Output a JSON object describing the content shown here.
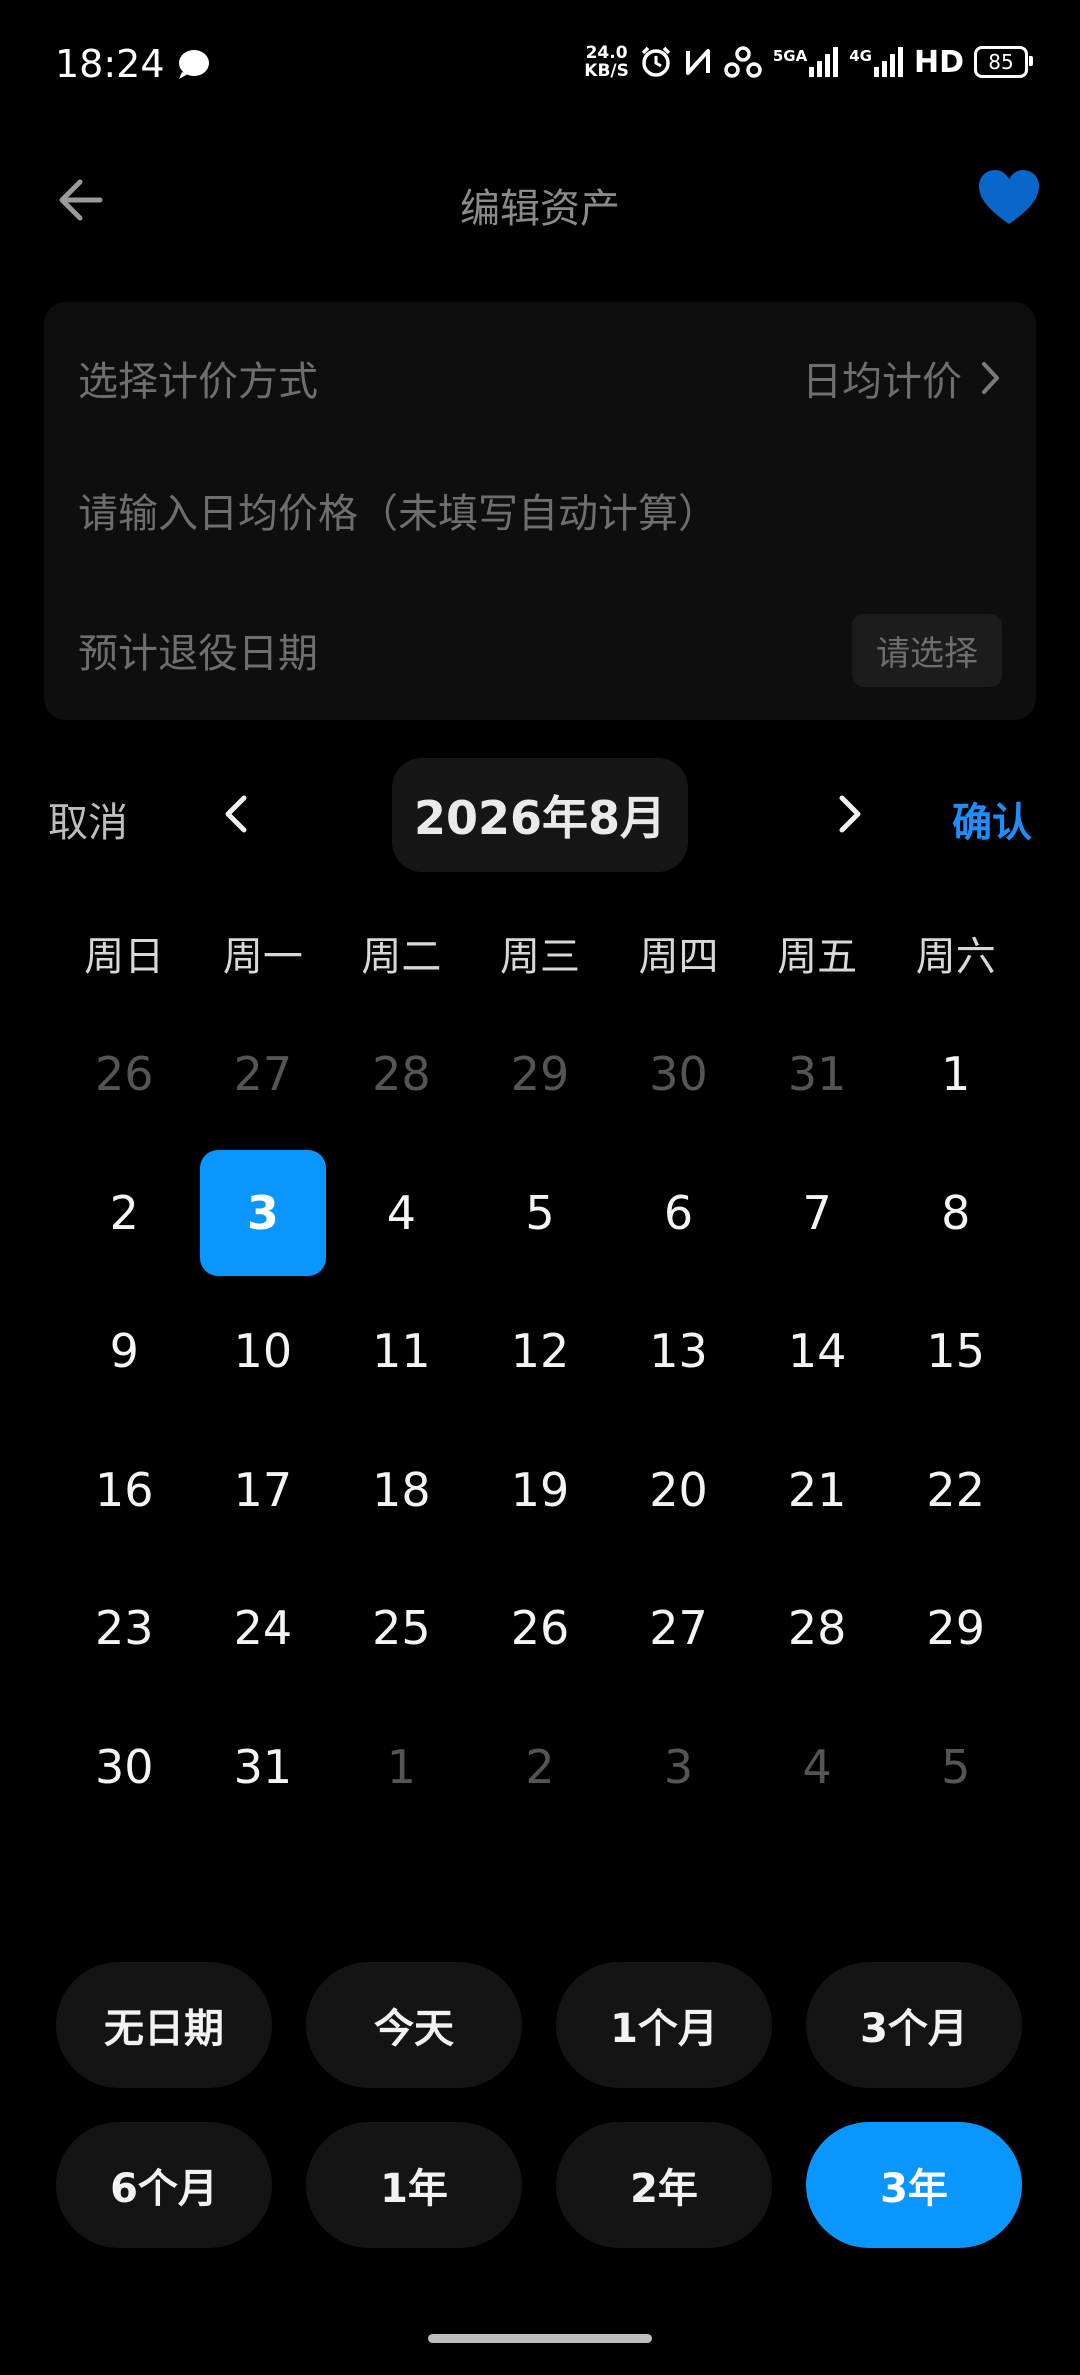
{
  "status_bar": {
    "time": "18:24",
    "speed_value": "24.0",
    "speed_unit": "KB/S",
    "signal1_label": "5GA",
    "signal2_label": "4G",
    "hd_label": "HD",
    "battery": "85",
    "icons": [
      "message-bubble-icon",
      "alarm-icon",
      "nfc-icon",
      "hotspot-icon",
      "signal-icon",
      "signal-icon",
      "battery-icon"
    ]
  },
  "header": {
    "title": "编辑资产",
    "back_icon": "arrow-left-icon",
    "favorite_icon": "heart-icon",
    "favorite_color": "#0a66c8"
  },
  "form": {
    "pricing_method_label": "选择计价方式",
    "pricing_method_value": "日均计价",
    "daily_price_placeholder": "请输入日均价格（未填写自动计算）",
    "retire_date_label": "预计退役日期",
    "retire_date_button": "请选择"
  },
  "calendar": {
    "cancel_label": "取消",
    "confirm_label": "确认",
    "month_label": "2026年8月",
    "weekdays": [
      "周日",
      "周一",
      "周二",
      "周三",
      "周四",
      "周五",
      "周六"
    ],
    "selected_day": 3,
    "weeks": [
      [
        {
          "d": "26",
          "m": true
        },
        {
          "d": "27",
          "m": true
        },
        {
          "d": "28",
          "m": true
        },
        {
          "d": "29",
          "m": true
        },
        {
          "d": "30",
          "m": true
        },
        {
          "d": "31",
          "m": true
        },
        {
          "d": "1",
          "m": false
        }
      ],
      [
        {
          "d": "2",
          "m": false
        },
        {
          "d": "3",
          "m": false,
          "s": true
        },
        {
          "d": "4",
          "m": false
        },
        {
          "d": "5",
          "m": false
        },
        {
          "d": "6",
          "m": false
        },
        {
          "d": "7",
          "m": false
        },
        {
          "d": "8",
          "m": false
        }
      ],
      [
        {
          "d": "9",
          "m": false
        },
        {
          "d": "10",
          "m": false
        },
        {
          "d": "11",
          "m": false
        },
        {
          "d": "12",
          "m": false
        },
        {
          "d": "13",
          "m": false
        },
        {
          "d": "14",
          "m": false
        },
        {
          "d": "15",
          "m": false
        }
      ],
      [
        {
          "d": "16",
          "m": false
        },
        {
          "d": "17",
          "m": false
        },
        {
          "d": "18",
          "m": false
        },
        {
          "d": "19",
          "m": false
        },
        {
          "d": "20",
          "m": false
        },
        {
          "d": "21",
          "m": false
        },
        {
          "d": "22",
          "m": false
        }
      ],
      [
        {
          "d": "23",
          "m": false
        },
        {
          "d": "24",
          "m": false
        },
        {
          "d": "25",
          "m": false
        },
        {
          "d": "26",
          "m": false
        },
        {
          "d": "27",
          "m": false
        },
        {
          "d": "28",
          "m": false
        },
        {
          "d": "29",
          "m": false
        }
      ],
      [
        {
          "d": "30",
          "m": false
        },
        {
          "d": "31",
          "m": false
        },
        {
          "d": "1",
          "m": true
        },
        {
          "d": "2",
          "m": true
        },
        {
          "d": "3",
          "m": true
        },
        {
          "d": "4",
          "m": true
        },
        {
          "d": "5",
          "m": true
        }
      ]
    ],
    "accent_color": "#0a96ff"
  },
  "quick_options": [
    {
      "label": "无日期",
      "active": false
    },
    {
      "label": "今天",
      "active": false
    },
    {
      "label": "1个月",
      "active": false
    },
    {
      "label": "3个月",
      "active": false
    },
    {
      "label": "6个月",
      "active": false
    },
    {
      "label": "1年",
      "active": false
    },
    {
      "label": "2年",
      "active": false
    },
    {
      "label": "3年",
      "active": true
    }
  ]
}
